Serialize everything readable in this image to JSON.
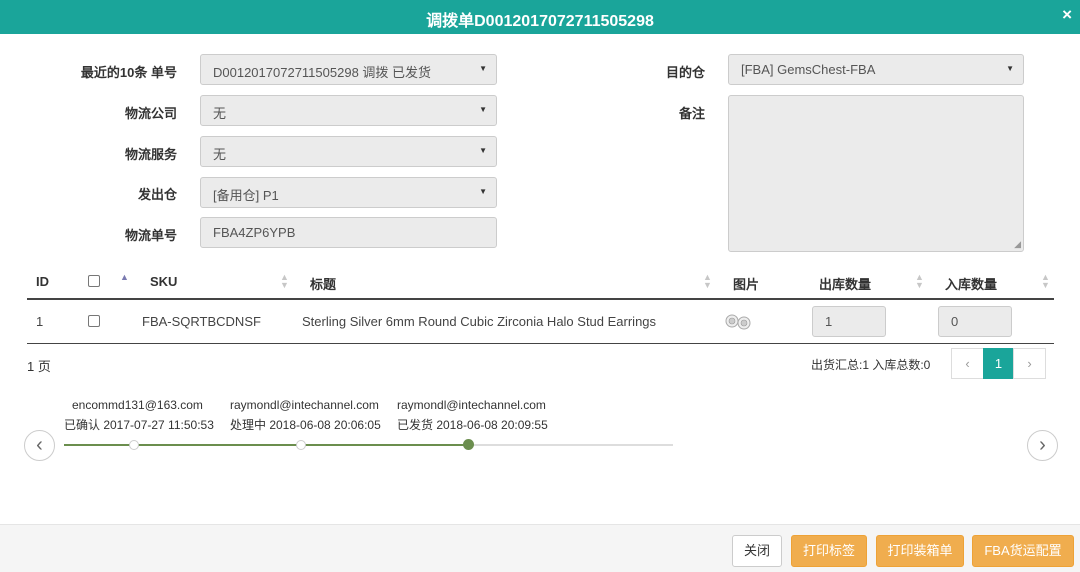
{
  "header": {
    "title": "调拨单D0012017072711505298",
    "close": "×"
  },
  "form": {
    "recent": {
      "label": "最近的10条 单号",
      "value": "D0012017072711505298 调拨 已发货"
    },
    "carrier": {
      "label": "物流公司",
      "value": "无"
    },
    "service": {
      "label": "物流服务",
      "value": "无"
    },
    "from_wh": {
      "label": "发出仓",
      "value": "[备用仓] P1"
    },
    "tracking": {
      "label": "物流单号",
      "value": "FBA4ZP6YPB"
    },
    "dest_wh": {
      "label": "目的仓",
      "value": "[FBA] GemsChest-FBA"
    },
    "note": {
      "label": "备注",
      "value": ""
    }
  },
  "table": {
    "headers": {
      "id": "ID",
      "sku": "SKU",
      "title": "标题",
      "image": "图片",
      "out_qty": "出库数量",
      "in_qty": "入库数量"
    },
    "rows": [
      {
        "id": "1",
        "sku": "FBA-SQRTBCDNSF",
        "title": "Sterling Silver 6mm Round Cubic Zirconia Halo Stud Earrings",
        "out_qty": "1",
        "in_qty": "0"
      }
    ]
  },
  "pagination": {
    "pages": "1 页",
    "summary": "出货汇总:1 入库总数:0",
    "prev": "‹",
    "current": "1",
    "next": "›"
  },
  "timeline": {
    "prev": "‹",
    "next": "›",
    "steps": [
      {
        "user": "encommd131@163.com",
        "status": "已确认 2017-07-27 11:50:53",
        "done": false
      },
      {
        "user": "raymondl@intechannel.com",
        "status": "处理中 2018-06-08 20:06:05",
        "done": false
      },
      {
        "user": "raymondl@intechannel.com",
        "status": "已发货 2018-06-08 20:09:55",
        "done": true
      }
    ]
  },
  "footer": {
    "close": "关闭",
    "print_label": "打印标签",
    "print_packing": "打印装箱单",
    "fba_config": "FBA货运配置"
  },
  "colors": {
    "primary": "#1aa59a",
    "warning": "#f0ad4e",
    "timeline_done": "#6b8e4e"
  }
}
